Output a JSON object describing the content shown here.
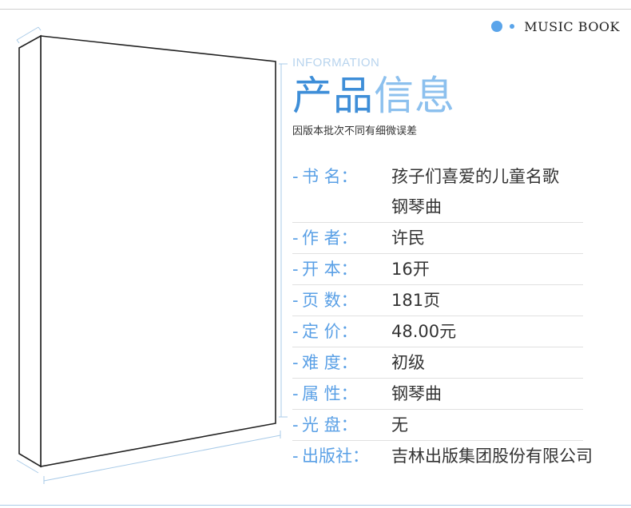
{
  "brand": {
    "text": "MUSIC BOOK"
  },
  "header": {
    "eng": "INFORMATION",
    "title_dark": "产品",
    "title_light": "信息",
    "note": "因版本批次不同有细微误差"
  },
  "info": {
    "rows": [
      {
        "label": "书  名：",
        "values": [
          "孩子们喜爱的儿童名歌",
          "钢琴曲"
        ]
      },
      {
        "label": "作  者：",
        "values": [
          "许民"
        ]
      },
      {
        "label": "开  本：",
        "values": [
          "16开"
        ]
      },
      {
        "label": "页  数：",
        "values": [
          "181页"
        ]
      },
      {
        "label": "定  价：",
        "values": [
          "48.00元"
        ]
      },
      {
        "label": "难  度：",
        "values": [
          "初级"
        ]
      },
      {
        "label": "属  性：",
        "values": [
          "钢琴曲"
        ]
      },
      {
        "label": "光  盘：",
        "values": [
          "无"
        ]
      },
      {
        "label": "出版社：",
        "values": [
          "吉林出版集团股份有限公司"
        ]
      }
    ]
  },
  "colors": {
    "accent": "#5aa0e6",
    "accent_dark": "#3e8ed8",
    "accent_light": "#8cc0ee"
  }
}
